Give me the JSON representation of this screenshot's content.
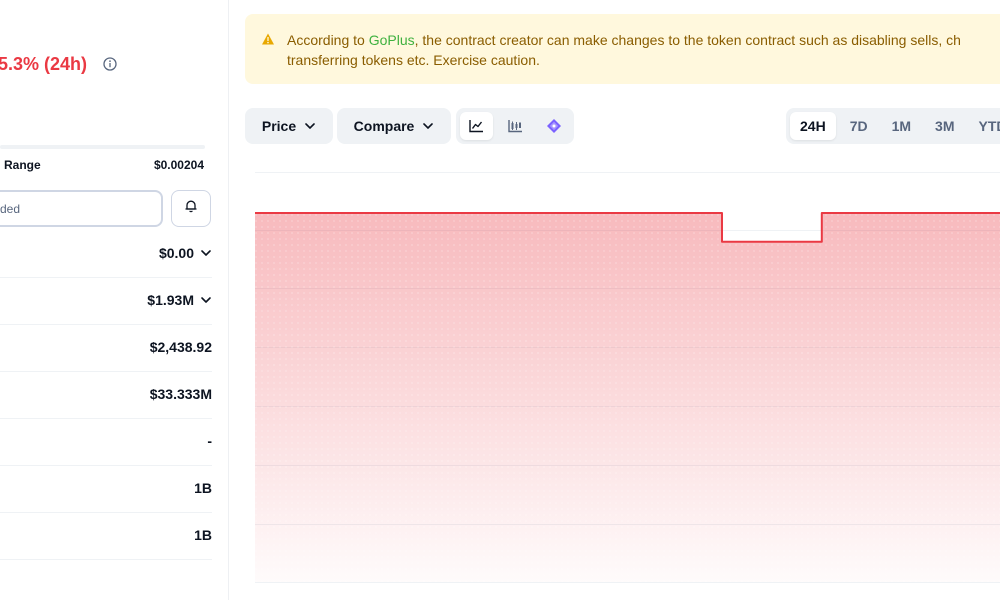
{
  "stats": {
    "price_change": "5.3% (24h)",
    "range_label": "Range",
    "range_value": "$0.00204",
    "input_placeholder": "ded",
    "rows": [
      {
        "value": "$0.00",
        "expandable": true
      },
      {
        "value": "$1.93M",
        "expandable": true
      },
      {
        "value": "$2,438.92",
        "expandable": false
      },
      {
        "value": "$33.333M",
        "expandable": false
      },
      {
        "value": "-",
        "expandable": false
      },
      {
        "value": "1B",
        "expandable": false
      },
      {
        "value": "1B",
        "expandable": false
      }
    ]
  },
  "alert": {
    "prefix": "According to ",
    "link": "GoPlus",
    "text": ", the contract creator can make changes to the token contract such as disabling sells, ch\ntransferring tokens etc. Exercise caution."
  },
  "toolbar": {
    "price_label": "Price",
    "compare_label": "Compare",
    "ranges": [
      "24H",
      "7D",
      "1M",
      "3M",
      "YTD"
    ],
    "active_range": "24H"
  },
  "colors": {
    "negative": "#ea3943",
    "alert_bg": "#fff8dd",
    "alert_text": "#8a5d00",
    "link": "#3fb13f",
    "line": "#ea3943"
  },
  "icons": [
    "info-icon",
    "bell-icon",
    "chevron-down-icon",
    "warning-icon",
    "line-chart-icon",
    "candlestick-icon",
    "tradingview-icon"
  ],
  "chart_data": {
    "type": "area",
    "values": [
      0.9,
      0.9,
      0.9,
      0.9,
      0.9,
      0.9,
      0.9,
      0.9,
      0.9,
      0.9,
      0.9,
      0.9,
      0.9,
      0.9,
      0.9,
      0.9,
      0.9,
      0.9,
      0.9,
      0.9,
      0.9,
      0.9,
      0.9,
      0.9,
      0.9,
      0.9,
      0.9,
      0.9,
      0.9,
      0.9,
      0.9,
      0.9,
      0.9,
      0.9,
      0.9,
      0.9,
      0.9,
      0.9,
      0.9,
      0.9,
      0.9,
      0.9,
      0.9,
      0.9,
      0.9,
      0.9,
      0.9,
      0.9,
      0.9,
      0.9,
      0.9,
      0.9,
      0.9,
      0.9,
      0.9,
      0.9,
      0.9,
      0.9,
      0.9,
      0.9,
      0.9,
      0.9,
      0.9,
      0.9,
      0.9,
      0.9,
      0.9,
      0.9,
      0.9,
      0.9,
      0.9,
      0.9,
      0.9,
      0.9,
      0.9,
      0.9,
      0.9,
      0.9,
      0.9,
      0.9,
      0.9,
      0.9,
      0.9,
      0.9,
      0.9,
      0.9,
      0.9,
      0.9,
      0.9,
      0.9,
      0.9,
      0.9,
      0.9,
      0.9,
      0.9,
      0.9,
      0.9,
      0.9,
      0.9,
      0.9,
      0.9,
      0.9,
      0.9,
      0.9,
      0.9,
      0.9,
      0.9,
      0.9,
      0.9,
      0.9,
      0.9,
      0.9,
      0.9,
      0.9,
      0.9,
      0.9,
      0.9,
      0.9,
      0.9,
      0.9,
      0.9,
      0.9,
      0.9,
      0.9,
      0.9,
      0.9,
      0.9,
      0.9,
      0.9,
      0.9,
      0.9,
      0.9,
      0.9,
      0.9,
      0.9,
      0.9,
      0.9,
      0.9,
      0.9,
      0.9,
      0.9,
      0.9,
      0.9,
      0.9,
      0.9,
      0.9,
      0.9,
      0.9,
      0.9,
      0.9,
      0.9,
      0.9,
      0.9,
      0.9,
      0.9,
      0.9,
      0.9,
      0.9,
      0.9,
      0.9,
      0.9,
      0.9,
      0.9,
      0.9,
      0.9,
      0.9,
      0.9,
      0.9,
      0.9,
      0.9,
      0.9,
      0.9,
      0.9,
      0.9,
      0.9,
      0.9,
      0.9,
      0.9,
      0.9,
      0.9,
      0.9,
      0.9,
      0.9,
      0.9,
      0.9,
      0.9,
      0.9,
      0.9,
      0.9,
      0.9,
      0.9,
      0.9,
      0.9,
      0.9,
      0.9,
      0.9,
      0.9,
      0.9,
      0.9,
      0.9,
      0.9,
      0.9,
      0.9,
      0.9,
      0.9,
      0.9,
      0.9,
      0.9,
      0.9,
      0.9
    ],
    "dip": {
      "start": 0.624,
      "end": 0.758,
      "value": 0.83
    },
    "ylim": [
      0,
      1
    ],
    "xlabel": "",
    "ylabel": "",
    "title": ""
  }
}
